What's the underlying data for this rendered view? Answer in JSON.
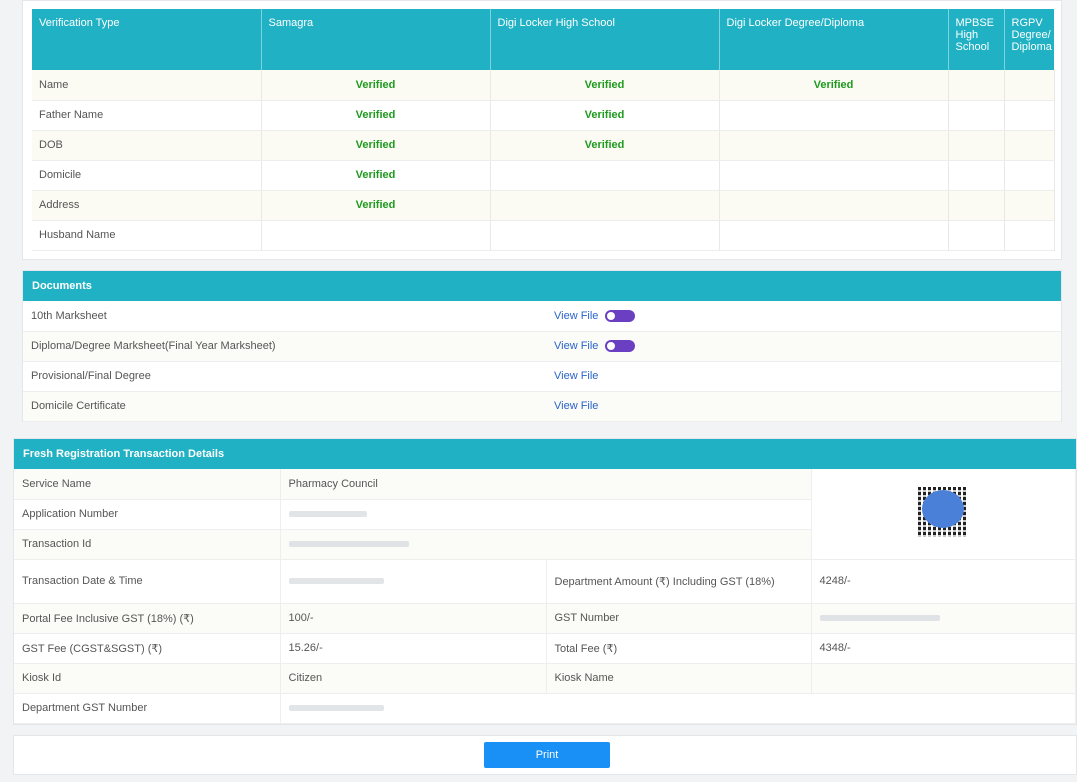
{
  "verification": {
    "headers": [
      "Verification Type",
      "Samagra",
      "Digi Locker High School",
      "Digi Locker Degree/Diploma",
      "MPBSE High School",
      "RGPV Degree/ Diploma"
    ],
    "rows": [
      {
        "type": "Name",
        "cells": [
          "Verified",
          "Verified",
          "Verified",
          "",
          ""
        ]
      },
      {
        "type": "Father Name",
        "cells": [
          "Verified",
          "Verified",
          "",
          "",
          ""
        ]
      },
      {
        "type": "DOB",
        "cells": [
          "Verified",
          "Verified",
          "",
          "",
          ""
        ]
      },
      {
        "type": "Domicile",
        "cells": [
          "Verified",
          "",
          "",
          "",
          ""
        ]
      },
      {
        "type": "Address",
        "cells": [
          "Verified",
          "",
          "",
          "",
          ""
        ]
      },
      {
        "type": "Husband Name",
        "cells": [
          "",
          "",
          "",
          "",
          ""
        ]
      }
    ]
  },
  "documents": {
    "title": "Documents",
    "items": [
      {
        "name": "10th Marksheet",
        "link": "View File",
        "toggle": true
      },
      {
        "name": "Diploma/Degree Marksheet(Final Year Marksheet)",
        "link": "View File",
        "toggle": true
      },
      {
        "name": "Provisional/Final Degree",
        "link": "View File",
        "toggle": false
      },
      {
        "name": "Domicile Certificate",
        "link": "View File",
        "toggle": false
      }
    ]
  },
  "transaction": {
    "title": "Fresh Registration Transaction Details",
    "service_name_label": "Service Name",
    "service_name_value": "Pharmacy Council",
    "application_number_label": "Application Number",
    "transaction_id_label": "Transaction Id",
    "datetime_label": "Transaction Date & Time",
    "dept_amount_label": "Department Amount (₹) Including GST (18%)",
    "dept_amount_value": "4248/-",
    "portal_fee_label": "Portal Fee Inclusive GST (18%) (₹)",
    "portal_fee_value": "100/-",
    "gst_number_label": "GST Number",
    "gst_fee_label": "GST Fee (CGST&SGST) (₹)",
    "gst_fee_value": "15.26/-",
    "total_fee_label": "Total Fee (₹)",
    "total_fee_value": "4348/-",
    "kiosk_id_label": "Kiosk Id",
    "kiosk_id_value": "Citizen",
    "kiosk_name_label": "Kiosk Name",
    "dept_gst_label": "Department GST Number"
  },
  "print": {
    "label": "Print"
  },
  "colors": {
    "accent": "#20b2c4",
    "verified": "#1e9a1e",
    "link": "#2a64c7",
    "button": "#1890f5"
  }
}
